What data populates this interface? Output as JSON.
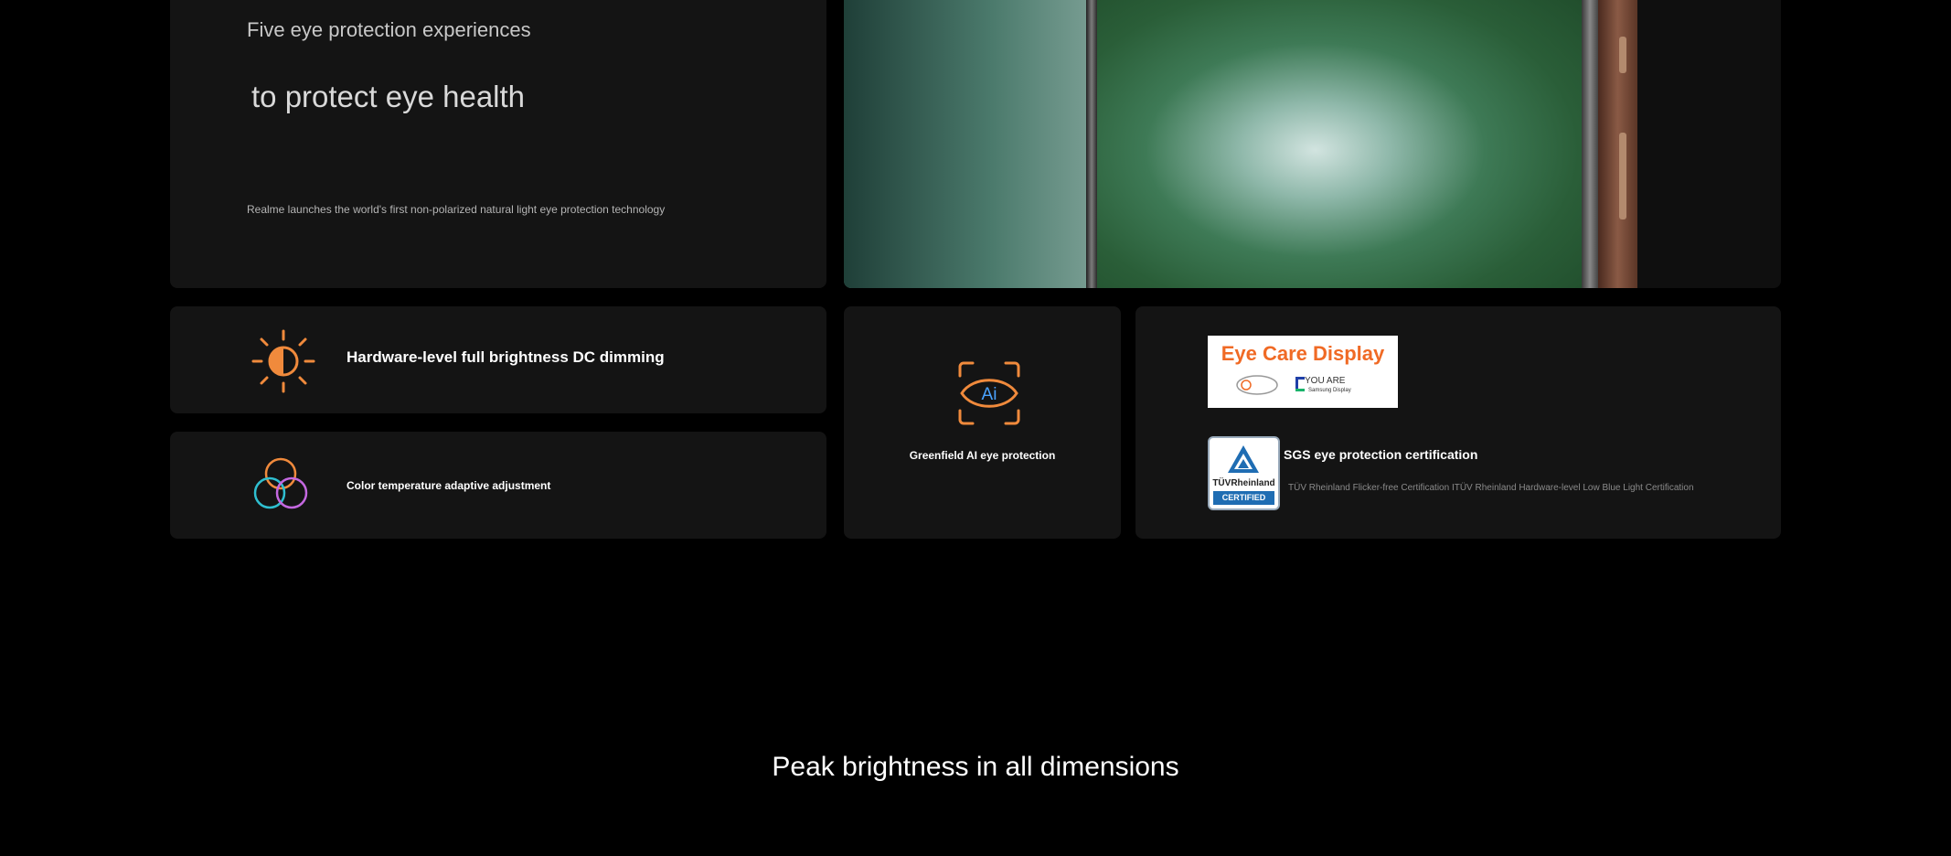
{
  "hero": {
    "subtitle": "Five eye protection experiences",
    "title": "to protect eye health",
    "description": "Realme launches the world's first non-polarized natural light eye protection technology"
  },
  "features": {
    "dc_dimming": "Hardware-level full brightness DC dimming",
    "color_temp": "Color temperature adaptive adjustment",
    "ai_protection": "Greenfield AI eye protection"
  },
  "certifications": {
    "eye_care_logo_title": "Eye Care Display",
    "eye_care_logo_tagline": "YOU ARE",
    "eye_care_logo_brand": "Samsung Display",
    "tuv_badge_name": "TÜVRheinland",
    "tuv_badge_label": "CERTIFIED",
    "sgs_title": "SGS eye protection certification",
    "sgs_description": "TÜV Rheinland Flicker-free Certification ITÜV Rheinland Hardware-level Low Blue Light Certification"
  },
  "section": {
    "title": "Peak brightness in all dimensions"
  },
  "colors": {
    "accent_orange": "#f08a3c",
    "card_background": "#141414"
  },
  "icons": [
    "sun-half-icon",
    "overlapping-circles-icon",
    "ai-eye-icon",
    "tuv-certified-icon"
  ]
}
